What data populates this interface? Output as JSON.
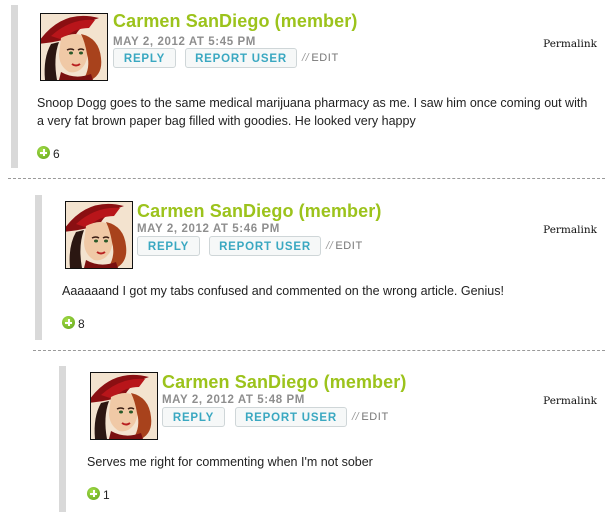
{
  "comments": [
    {
      "author": "Carmen SanDiego (member)",
      "date": "MAY 2, 2012 AT 5:45 PM",
      "reply_label": "REPLY",
      "report_label": "REPORT USER",
      "edit_sep": "//",
      "edit_label": "EDIT",
      "permalink_label": "Permalink",
      "text": "Snoop Dogg goes to the same medical marijuana pharmacy as me. I saw him once coming out with a very fat brown paper bag filled with goodies. He looked very happy",
      "votes": "6"
    },
    {
      "author": "Carmen SanDiego (member)",
      "date": "MAY 2, 2012 AT 5:46 PM",
      "reply_label": "REPLY",
      "report_label": "REPORT USER",
      "edit_sep": "//",
      "edit_label": "EDIT",
      "permalink_label": "Permalink",
      "text": "Aaaaaand I got my tabs confused and commented on the wrong article. Genius!",
      "votes": "8"
    },
    {
      "author": "Carmen SanDiego (member)",
      "date": "MAY 2, 2012 AT 5:48 PM",
      "reply_label": "REPLY",
      "report_label": "REPORT USER",
      "edit_sep": "//",
      "edit_label": "EDIT",
      "permalink_label": "Permalink",
      "text": "Serves me right for commenting when I'm not sober",
      "votes": "1"
    }
  ]
}
